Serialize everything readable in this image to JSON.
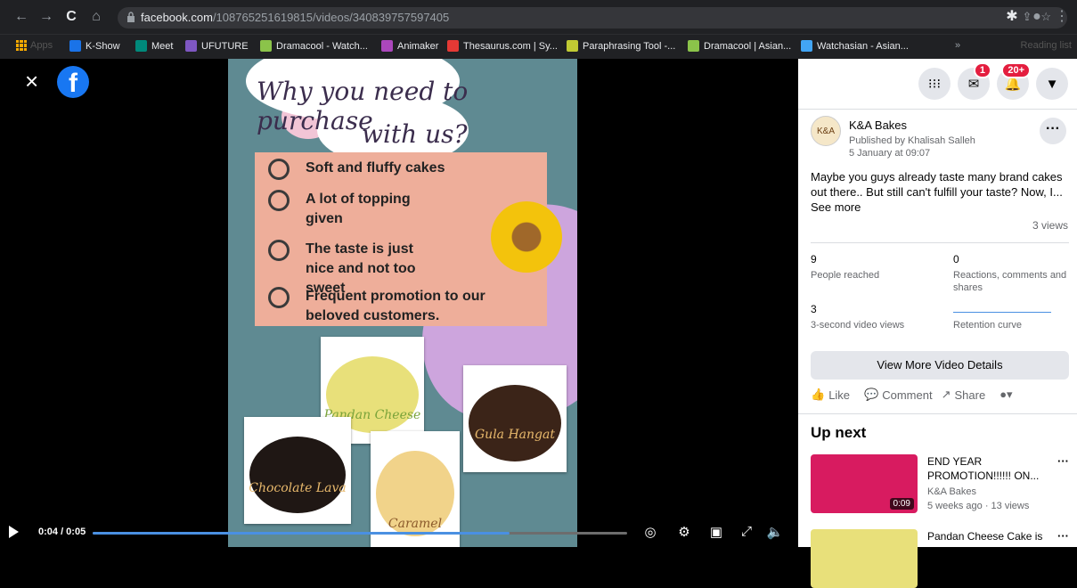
{
  "browser": {
    "url_domain": "facebook.com",
    "url_path": "/108765251619815/videos/340839757597405"
  },
  "bookmarks": [
    {
      "label": "Apps",
      "color": "#f9ab00"
    },
    {
      "label": "K-Show",
      "color": "#1a73e8"
    },
    {
      "label": "Meet",
      "color": "#00897b"
    },
    {
      "label": "UFUTURE",
      "color": "#7e57c2"
    },
    {
      "label": "Dramacool - Watch...",
      "color": "#8bc34a"
    },
    {
      "label": "Animaker",
      "color": "#ab47bc"
    },
    {
      "label": "Thesaurus.com | Sy...",
      "color": "#e53935"
    },
    {
      "label": "Paraphrasing Tool -...",
      "color": "#c0ca33"
    },
    {
      "label": "Dramacool | Asian...",
      "color": "#8bc34a"
    },
    {
      "label": "Watchasian - Asian...",
      "color": "#42a5f5"
    }
  ],
  "bookmarks_more": "»",
  "reading_list": "Reading list",
  "video": {
    "close": "×",
    "fb_logo": "f",
    "poster": {
      "title_line1": "Why you need to purchase",
      "title_line2": "with us?",
      "items": [
        "Soft and fluffy cakes",
        "A lot of topping given",
        "The taste is just nice and not too sweet",
        "Frequent promotion to our beloved customers."
      ],
      "cakes": [
        {
          "caption": "Pandan Cheese",
          "color": "#e8e07a"
        },
        {
          "caption": "Gula Hangat",
          "color": "#3b2418"
        },
        {
          "caption": "Chocolate Lava",
          "color": "#1f1714"
        },
        {
          "caption": "Caramel",
          "color": "#f1d38a"
        }
      ]
    },
    "controls": {
      "time": "0:04 / 0:05",
      "progress_fraction": 0.78
    }
  },
  "sidebar": {
    "top_badges": {
      "messenger": "1",
      "notifications": "20+"
    },
    "post": {
      "page_name": "K&A Bakes",
      "avatar_text": "K&A",
      "published_by": "Published by Khalisah Salleh",
      "date": "5 January at 09:07",
      "description": "Maybe you guys already taste many brand cakes out there.. But still can't fulfill your taste? Now, I...",
      "see_more": "See more",
      "views": "3 views",
      "stats": [
        {
          "value": "9",
          "label": "People reached"
        },
        {
          "value": "0",
          "label": "Reactions, comments and shares"
        },
        {
          "value": "3",
          "label": "3-second video views"
        },
        {
          "value": "",
          "label": "Retention curve"
        }
      ],
      "view_more_button": "View More Video Details",
      "actions": {
        "like": "Like",
        "comment": "Comment",
        "share": "Share"
      }
    },
    "up_next": {
      "title": "Up next",
      "items": [
        {
          "title": "END YEAR PROMOTION!!!!!! ON...",
          "channel": "K&A Bakes",
          "meta": "5 weeks ago · 13 views",
          "duration": "0:09",
          "color": "#d81b60"
        },
        {
          "title": "Pandan Cheese Cake is",
          "channel": "",
          "meta": "",
          "duration": "",
          "color": "#e8e07a"
        }
      ]
    }
  }
}
